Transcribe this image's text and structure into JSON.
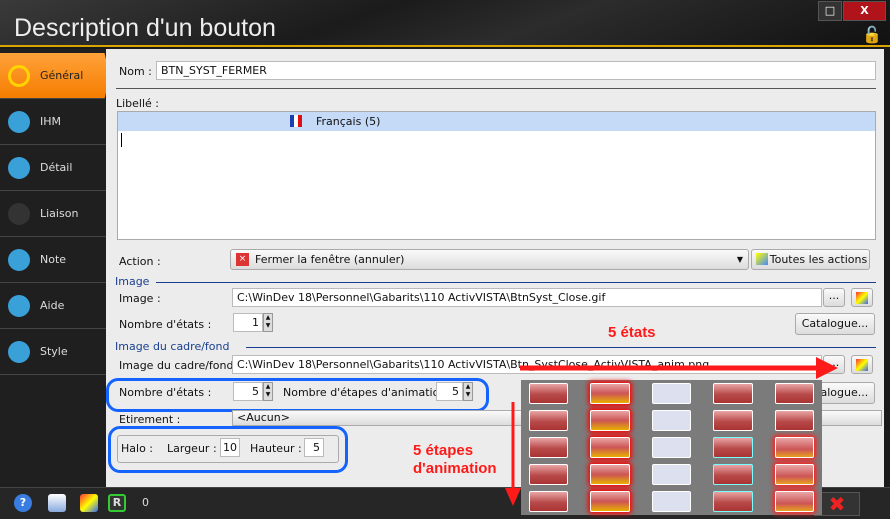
{
  "window": {
    "title": "Description d'un bouton",
    "maximize": "□",
    "close": "X"
  },
  "sidebar": {
    "items": [
      {
        "label": "Général",
        "icon": "general-icon",
        "active": true,
        "color": "#f5a000"
      },
      {
        "label": "IHM",
        "icon": "eye-icon",
        "color": "#3aa0d8"
      },
      {
        "label": "Détail",
        "icon": "detail-icon",
        "color": "#3aa0d8"
      },
      {
        "label": "Liaison",
        "icon": "link-icon",
        "color": "#333"
      },
      {
        "label": "Note",
        "icon": "note-icon",
        "color": "#3aa0d8"
      },
      {
        "label": "Aide",
        "icon": "help-icon",
        "color": "#3aa0d8"
      },
      {
        "label": "Style",
        "icon": "style-icon",
        "color": "#3aa0d8"
      }
    ]
  },
  "form": {
    "nom_label": "Nom :",
    "nom_value": "BTN_SYST_FERMER",
    "libelle_label": "Libellé :",
    "libelle_lang": "Français (5)",
    "action_label": "Action :",
    "action_value": "Fermer la fenêtre (annuler)",
    "all_actions": "Toutes les actions",
    "image_section": "Image",
    "image_label": "Image :",
    "image_value": "C:\\WinDev 18\\Personnel\\Gabarits\\110 ActivVISTA\\BtnSyst_Close.gif",
    "etats_label": "Nombre d'états :",
    "etats_value": "1",
    "catalogue": "Catalogue...",
    "browse": "...",
    "cadre_section": "Image du cadre/fond",
    "cadre_label": "Image du cadre/fond :",
    "cadre_value": "C:\\WinDev 18\\Personnel\\Gabarits\\110 ActivVISTA\\Btn_SystClose_ActivVISTA_anim.png",
    "cadre_etats_label": "Nombre d'états :",
    "cadre_etats_value": "5",
    "anim_label": "Nombre d'étapes d'animation :",
    "anim_value": "5",
    "etirement_label": "Etirement :",
    "etirement_value": "<Aucun>",
    "halo_label": "Halo :",
    "largeur_label": "Largeur :",
    "largeur_value": "10",
    "hauteur_label": "Hauteur :",
    "hauteur_value": "5"
  },
  "annotations": {
    "states": "5 états",
    "steps_line1": "5 étapes",
    "steps_line2": "d'animation",
    "color": "#ff1a1a"
  },
  "preview_grid": [
    [
      "red",
      "glow",
      "pale",
      "red",
      "red"
    ],
    [
      "red",
      "glow",
      "pale",
      "red",
      "red"
    ],
    [
      "red",
      "glow",
      "pale",
      "cyan",
      "glow2"
    ],
    [
      "red",
      "glow",
      "pale",
      "cyan",
      "glow2"
    ],
    [
      "red",
      "glow",
      "pale",
      "cyan",
      "glow2"
    ]
  ],
  "bottombar": {
    "counter": "0"
  }
}
